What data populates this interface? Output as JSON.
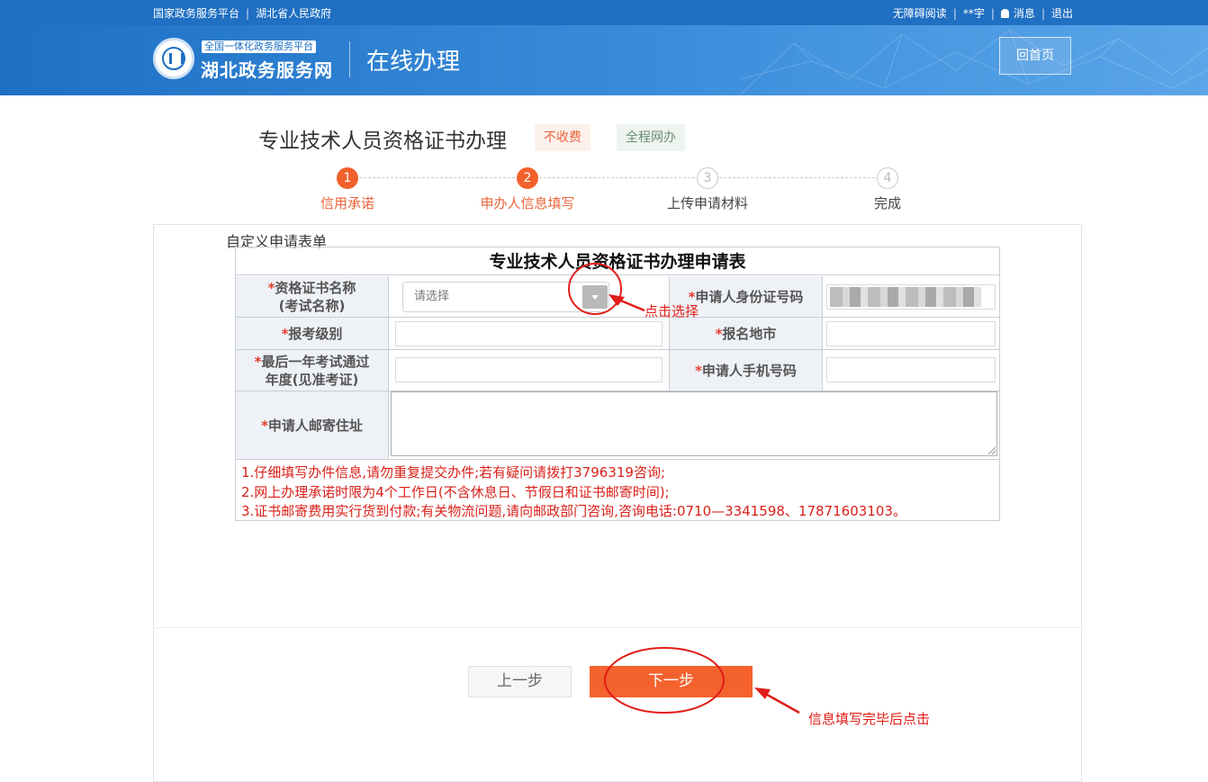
{
  "topbar": {
    "left_links": [
      "国家政务服务平台",
      "湖北省人民政府"
    ],
    "accessibility": "无障碍阅读",
    "user": "**宇",
    "messages": "消息",
    "logout": "退出"
  },
  "header": {
    "brand_sub": "全国一体化政务服务平台",
    "brand_main": "湖北政务服务网",
    "section": "在线办理",
    "home_button": "回首页"
  },
  "page": {
    "title": "专业技术人员资格证书办理",
    "tags": [
      "不收费",
      "全程网办"
    ]
  },
  "steps": [
    {
      "num": "1",
      "label": "信用承诺",
      "state": "done"
    },
    {
      "num": "2",
      "label": "申办人信息填写",
      "state": "current"
    },
    {
      "num": "3",
      "label": "上传申请材料",
      "state": "todo"
    },
    {
      "num": "4",
      "label": "完成",
      "state": "todo"
    }
  ],
  "form": {
    "caption": "自定义申请表单",
    "title": "专业技术人员资格证书办理申请表",
    "required_mark": "*",
    "fields": {
      "cert_name_line1": "资格证书名称",
      "cert_name_line2": "(考试名称)",
      "id_number": "申请人身份证号码",
      "exam_level": "报考级别",
      "reg_city": "报名地市",
      "last_year_line1": "最后一年考试通过",
      "last_year_line2": "年度(见准考证)",
      "phone": "申请人手机号码",
      "address": "申请人邮寄住址"
    },
    "select_placeholder": "请选择",
    "notes": [
      "1.仔细填写办件信息,请勿重复提交办件;若有疑问请拨打3796319咨询;",
      "2.网上办理承诺时限为4个工作日(不含休息日、节假日和证书邮寄时间);",
      "3.证书邮寄费用实行货到付款;有关物流问题,请向邮政部门咨询,咨询电话:0710—3341598、17871603103。"
    ]
  },
  "annotations": {
    "click_select": "点击选择",
    "click_after_fill": "信息填写完毕后点击",
    "color": "#e11d17"
  },
  "buttons": {
    "prev": "上一步",
    "next": "下一步"
  },
  "colors": {
    "topbar": "#1f6fc2",
    "accent": "#f4622d",
    "required": "#e63b2e",
    "notes": "#d9211a"
  }
}
